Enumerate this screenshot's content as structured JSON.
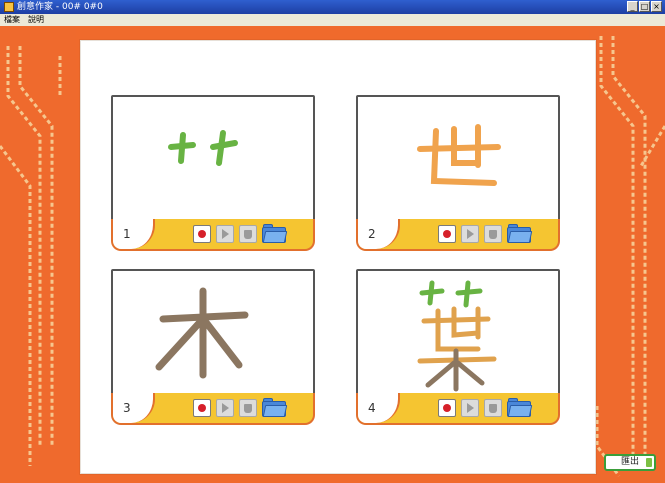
{
  "window": {
    "title": "創意作家 - 00# 0#0",
    "controls": [
      "_",
      "□",
      "×"
    ]
  },
  "menu": {
    "items": [
      "檔案",
      "說明"
    ]
  },
  "cards": [
    {
      "number": "1",
      "character_strokes": "艹",
      "ink_color": "#68b343"
    },
    {
      "number": "2",
      "character_strokes": "世",
      "ink_color": "#f0a34d"
    },
    {
      "number": "3",
      "character_strokes": "木",
      "ink_color": "#8b7660"
    },
    {
      "number": "4",
      "character_strokes": "葉",
      "ink_color": "#e0a24d"
    }
  ],
  "toolbar_icons": [
    "record-icon",
    "play-icon",
    "trash-icon",
    "folder-icon"
  ],
  "exit_button": {
    "label": "匯出"
  },
  "colors": {
    "background": "#f06a2c",
    "toolbar": "#f5c531",
    "accent_border": "#e2702d",
    "record": "#d6202a",
    "folder": "#4a87d8",
    "exit_border": "#3a9e3a"
  }
}
